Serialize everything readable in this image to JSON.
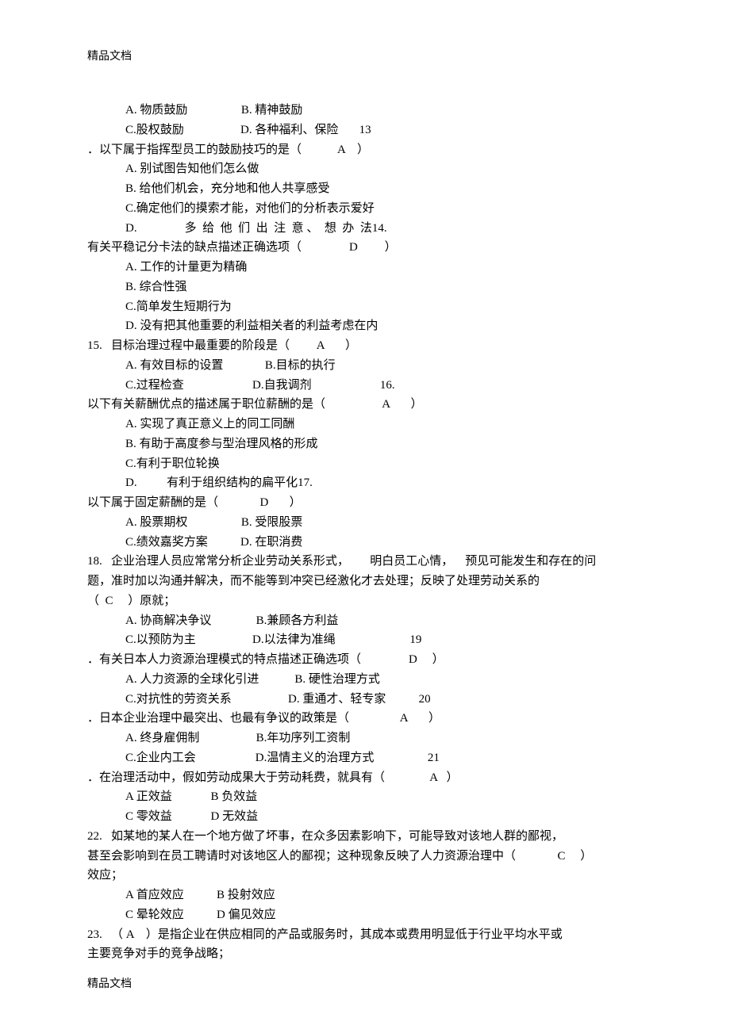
{
  "header": "精品文档",
  "footer": "精品文档",
  "lines": [
    {
      "cls": "indent",
      "text": "A. 物质鼓励                  B. 精神鼓励"
    },
    {
      "cls": "indent",
      "text": "C.股权鼓励                   D. 各种福利、保险       13"
    },
    {
      "cls": "",
      "text": "．以下属于指挥型员工的鼓励技巧的是（            A    ）"
    },
    {
      "cls": "indent",
      "text": "A. 别试图告知他们怎么做"
    },
    {
      "cls": "indent",
      "text": "B. 给他们机会，充分地和他人共享感受"
    },
    {
      "cls": "indent",
      "text": "C.确定他们的摸索才能，对他们的分析表示爱好"
    },
    {
      "cls": "indent",
      "text": "D.                多  给  他  们  出  注  意 、  想  办  法14."
    },
    {
      "cls": "",
      "text": "有关平稳记分卡法的缺点描述正确选项（                D         ）"
    },
    {
      "cls": "indent",
      "text": "A. 工作的计量更为精确"
    },
    {
      "cls": "indent",
      "text": "B. 综合性强"
    },
    {
      "cls": "indent",
      "text": "C.简单发生短期行为"
    },
    {
      "cls": "indent",
      "text": "D. 没有把其他重要的利益相关者的利益考虑在内"
    },
    {
      "cls": "",
      "text": "15.   目标治理过程中最重要的阶段是（         A       ）"
    },
    {
      "cls": "indent",
      "text": "A. 有效目标的设置              B.目标的执行"
    },
    {
      "cls": "indent",
      "text": "C.过程检查                       D.自我调剂                       16."
    },
    {
      "cls": "",
      "text": "以下有关薪酬优点的描述属于职位薪酬的是（                   A       ）"
    },
    {
      "cls": "indent",
      "text": "A. 实现了真正意义上的同工同酬"
    },
    {
      "cls": "indent",
      "text": "B. 有助于高度参与型治理风格的形成"
    },
    {
      "cls": "indent",
      "text": "C.有利于职位轮换"
    },
    {
      "cls": "indent",
      "text": "D.          有利于组织结构的扁平化17."
    },
    {
      "cls": "",
      "text": "以下属于固定薪酬的是（              D       ）"
    },
    {
      "cls": "indent",
      "text": "A. 股票期权                  B. 受限股票"
    },
    {
      "cls": "indent",
      "text": "C.绩效嘉奖方案           D. 在职消费"
    },
    {
      "cls": "",
      "text": "18.   企业治理人员应常常分析企业劳动关系形式，       明白员工心情，    预见可能发生和存在的问"
    },
    {
      "cls": "",
      "text": "题，准时加以沟通并解决，而不能等到冲突已经激化才去处理；反映了处理劳动关系的"
    },
    {
      "cls": "",
      "text": "（  C     ）原就；"
    },
    {
      "cls": "indent",
      "text": "A. 协商解决争议               B.兼顾各方利益"
    },
    {
      "cls": "indent",
      "text": "C.以预防为主                   D.以法律为准绳                         19"
    },
    {
      "cls": "",
      "text": "．有关日本人力资源治理模式的特点描述正确选项（                D     ）"
    },
    {
      "cls": "indent",
      "text": "A. 人力资源的全球化引进            B. 硬性治理方式"
    },
    {
      "cls": "indent",
      "text": "C.对抗性的劳资关系                   D. 重通才、轻专家           20"
    },
    {
      "cls": "",
      "text": "．日本企业治理中最突出、也最有争议的政策是（                 A       ）"
    },
    {
      "cls": "indent",
      "text": "A. 终身雇佣制                   B.年功序列工资制"
    },
    {
      "cls": "indent",
      "text": "C.企业内工会                    D.温情主义的治理方式                  21"
    },
    {
      "cls": "",
      "text": "．在治理活动中，假如劳动成果大于劳动耗费，就具有（               A   ）"
    },
    {
      "cls": "indent",
      "text": "A 正效益             B 负效益"
    },
    {
      "cls": "indent",
      "text": "C 零效益             D 无效益"
    },
    {
      "cls": "",
      "text": "22.   如某地的某人在一个地方做了坏事，在众多因素影响下，可能导致对该地人群的鄙视，"
    },
    {
      "cls": "",
      "text": "甚至会影响到在员工聘请时对该地区人的鄙视；这种现象反映了人力资源治理中（              C     ）"
    },
    {
      "cls": "",
      "text": "效应；"
    },
    {
      "cls": "indent",
      "text": "A 首应效应           B 投射效应"
    },
    {
      "cls": "indent",
      "text": "C 晕轮效应           D 偏见效应"
    },
    {
      "cls": "",
      "text": "23.   （ A    ）是指企业在供应相同的产品或服务时，其成本或费用明显低于行业平均水平或"
    },
    {
      "cls": "",
      "text": "主要竞争对手的竞争战略；"
    }
  ]
}
